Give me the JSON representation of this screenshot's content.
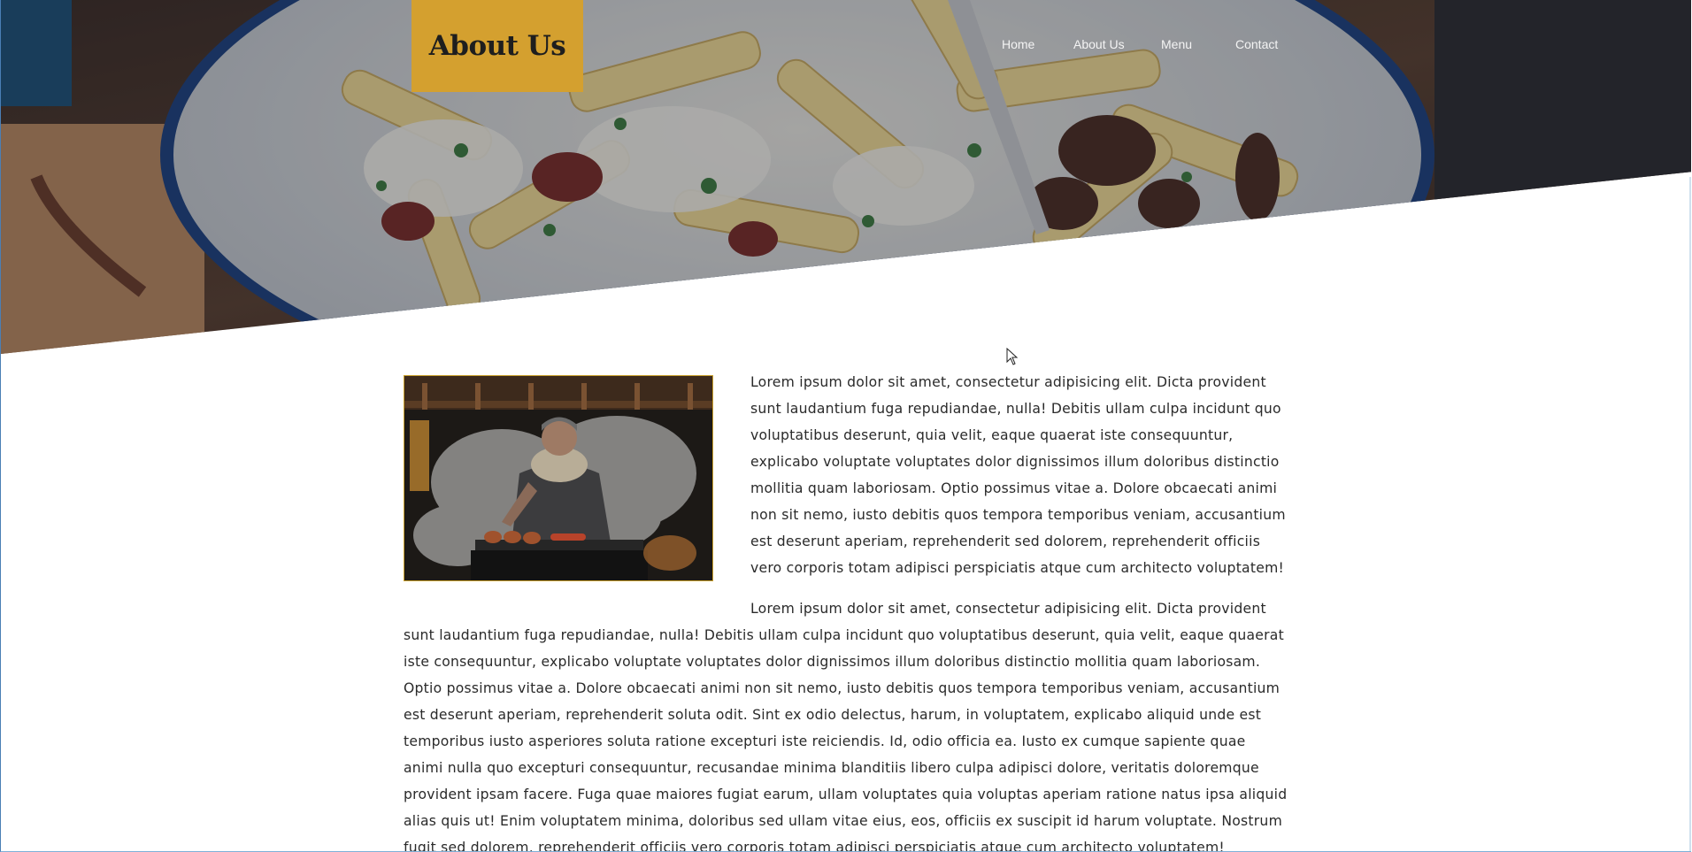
{
  "page": {
    "title": "About Us"
  },
  "nav": {
    "items": [
      {
        "label": "Home"
      },
      {
        "label": "About Us"
      },
      {
        "label": "Menu"
      },
      {
        "label": "Contact"
      }
    ]
  },
  "hero": {
    "image": "pasta-dish-photo"
  },
  "content": {
    "image": "chef-grilling-photo",
    "paragraph1": "Lorem ipsum dolor sit amet, consectetur adipisicing elit. Dicta provident sunt laudantium fuga repudiandae, nulla! Debitis ullam culpa incidunt quo voluptatibus deserunt, quia velit, eaque quaerat iste consequuntur, explicabo voluptate voluptates dolor dignissimos illum doloribus distinctio mollitia quam laboriosam. Optio possimus vitae a. Dolore obcaecati animi non sit nemo, iusto debitis quos tempora temporibus veniam, accusantium est deserunt aperiam, reprehenderit sed dolorem, reprehenderit officiis vero corporis totam adipisci perspiciatis atque cum architecto voluptatem!",
    "paragraph2": "Lorem ipsum dolor sit amet, consectetur adipisicing elit. Dicta provident sunt laudantium fuga repudiandae, nulla! Debitis ullam culpa incidunt quo voluptatibus deserunt, quia velit, eaque quaerat iste consequuntur, explicabo voluptate voluptates dolor dignissimos illum doloribus distinctio mollitia quam laboriosam. Optio possimus vitae a. Dolore obcaecati animi non sit nemo, iusto debitis quos tempora temporibus veniam, accusantium est deserunt aperiam, reprehenderit soluta odit. Sint ex odio delectus, harum, in voluptatem, explicabo aliquid unde est temporibus iusto asperiores soluta ratione excepturi iste reiciendis. Id, odio officia ea. Iusto ex cumque sapiente quae animi nulla quo excepturi consequuntur, recusandae minima blanditiis libero culpa adipisci dolore, veritatis doloremque provident ipsam facere. Fuga quae maiores fugiat earum, ullam voluptates quia voluptas aperiam ratione natus ipsa aliquid alias quis ut! Enim voluptatem minima, doloribus sed ullam vitae eius, eos, officiis ex suscipit id harum voluptate. Nostrum fugit sed dolorem, reprehenderit officiis vero corporis totam adipisci perspiciatis atque cum architecto voluptatem!"
  },
  "colors": {
    "accent": "#d4a02f",
    "text": "#2a2a2a",
    "nav_text": "#f4f4f4"
  },
  "cursor": {
    "icon": "mouse-pointer-icon"
  }
}
